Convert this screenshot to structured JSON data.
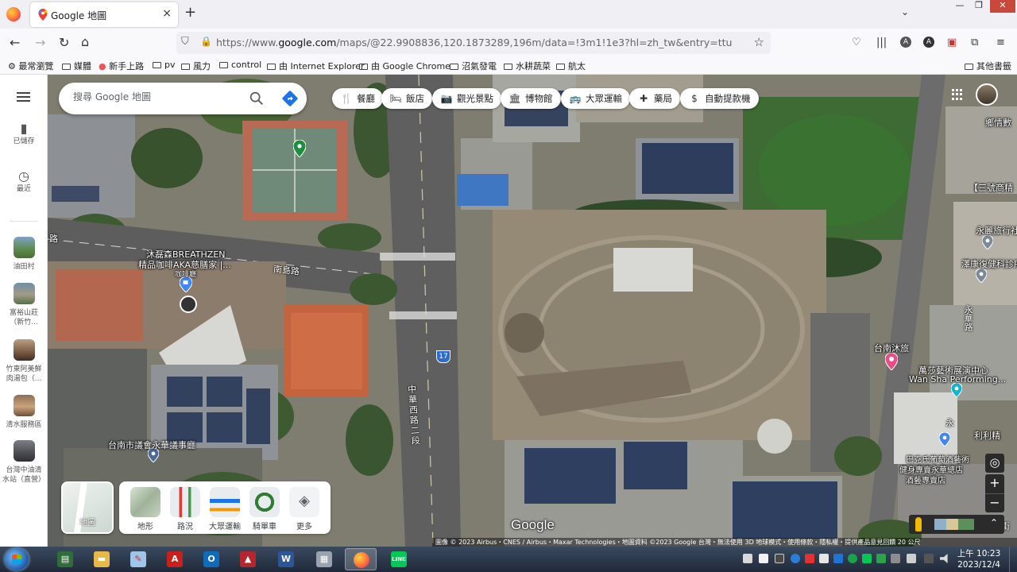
{
  "browser": {
    "tab_title": "Google 地圖",
    "tab_close": "×",
    "new_tab": "+",
    "url": "https://www.google.com/maps/@22.9908836,120.1873289,196m/data=!3m1!1e3?hl=zh_tw&entry=ttu",
    "url_host": "https://www.",
    "url_domain": "google.com",
    "url_rest": "/maps/@22.9908836,120.1873289,196m/data=!3m1!1e3?hl=zh_tw&entry=ttu",
    "bookmarks": [
      "最常瀏覽",
      "媒體",
      "新手上路",
      "pv",
      "風力",
      "control",
      "由 Internet Explorer",
      "由 Google Chrome",
      "沼氣發電",
      "水耕蔬菜",
      "航太"
    ],
    "other_bookmarks": "其他書籤"
  },
  "rail": {
    "saved": "已儲存",
    "recent": "最近",
    "places": [
      {
        "line1": "油田村",
        "line2": ""
      },
      {
        "line1": "富裕山莊",
        "line2": "（新竹..."
      },
      {
        "line1": "竹東阿美鮮",
        "line2": "肉湯包（..."
      },
      {
        "line1": "清水服務區",
        "line2": ""
      },
      {
        "line1": "台灣中油清",
        "line2": "水站（直營）"
      }
    ]
  },
  "search": {
    "placeholder": "搜尋 Google 地圖"
  },
  "chips": [
    {
      "icon": "fork-knife-icon",
      "glyph": "🍴",
      "label": "餐廳"
    },
    {
      "icon": "bed-icon",
      "glyph": "🛏",
      "label": "飯店"
    },
    {
      "icon": "camera-icon",
      "glyph": "📷",
      "label": "觀光景點"
    },
    {
      "icon": "museum-icon",
      "glyph": "🏛",
      "label": "博物館"
    },
    {
      "icon": "bus-icon",
      "glyph": "🚌",
      "label": "大眾運輸"
    },
    {
      "icon": "pharmacy-icon",
      "glyph": "✚",
      "label": "藥局"
    },
    {
      "icon": "atm-icon",
      "glyph": "$",
      "label": "自動提款機"
    }
  ],
  "map_labels": {
    "cafe_line1": "沐磊森BREATHZEN",
    "cafe_line2": "精品咖啡AKA慈膳家 |...",
    "cafe_type": "咖啡廳",
    "nandian_road": "南島路",
    "road_fragment": "路",
    "zhonghua_road": "中華西路二段",
    "route_shield": "17",
    "council": "台南市議會永華議事廳",
    "tainan_mu": "台南沐旅",
    "wansha_line1": "萬莎藝術展演中心",
    "wansha_line2": "Wan Sha Performing...",
    "yongli": "永麗旅行社",
    "zehui": "澤康復健科診所",
    "lili": "利利精",
    "sanhao": "【三號商精",
    "xiang": "鄉情數",
    "pujiu_line1": "巴克氏葡萄酒藝術",
    "pujiu_line2": "健身專賣永華總店",
    "pujiu_line3": "酒藝專賣店",
    "yong_road1": "永華路",
    "yong_road2": "永",
    "jie": "街"
  },
  "layers": {
    "map_card": "地圖",
    "items": [
      "地形",
      "路況",
      "大眾運輸",
      "騎單車",
      "更多"
    ]
  },
  "logo": "Google",
  "zoom": {
    "in": "+",
    "out": "−"
  },
  "attribution": "圖像 © 2023 Airbus・CNES / Airbus・Maxar Technologies・地圖資料 ©2023 Google     台灣・無法使用 3D 地球模式・使用條款・隱私權・提供產品意見回饋     20 公尺",
  "taskbar": {
    "time": "上午 10:23",
    "date": "2023/12/4"
  },
  "colors": {
    "pin_green": "#1e8e3e",
    "pin_blue": "#4285f4",
    "pin_pink": "#ea4c89",
    "directions_blue": "#1a73e8"
  }
}
